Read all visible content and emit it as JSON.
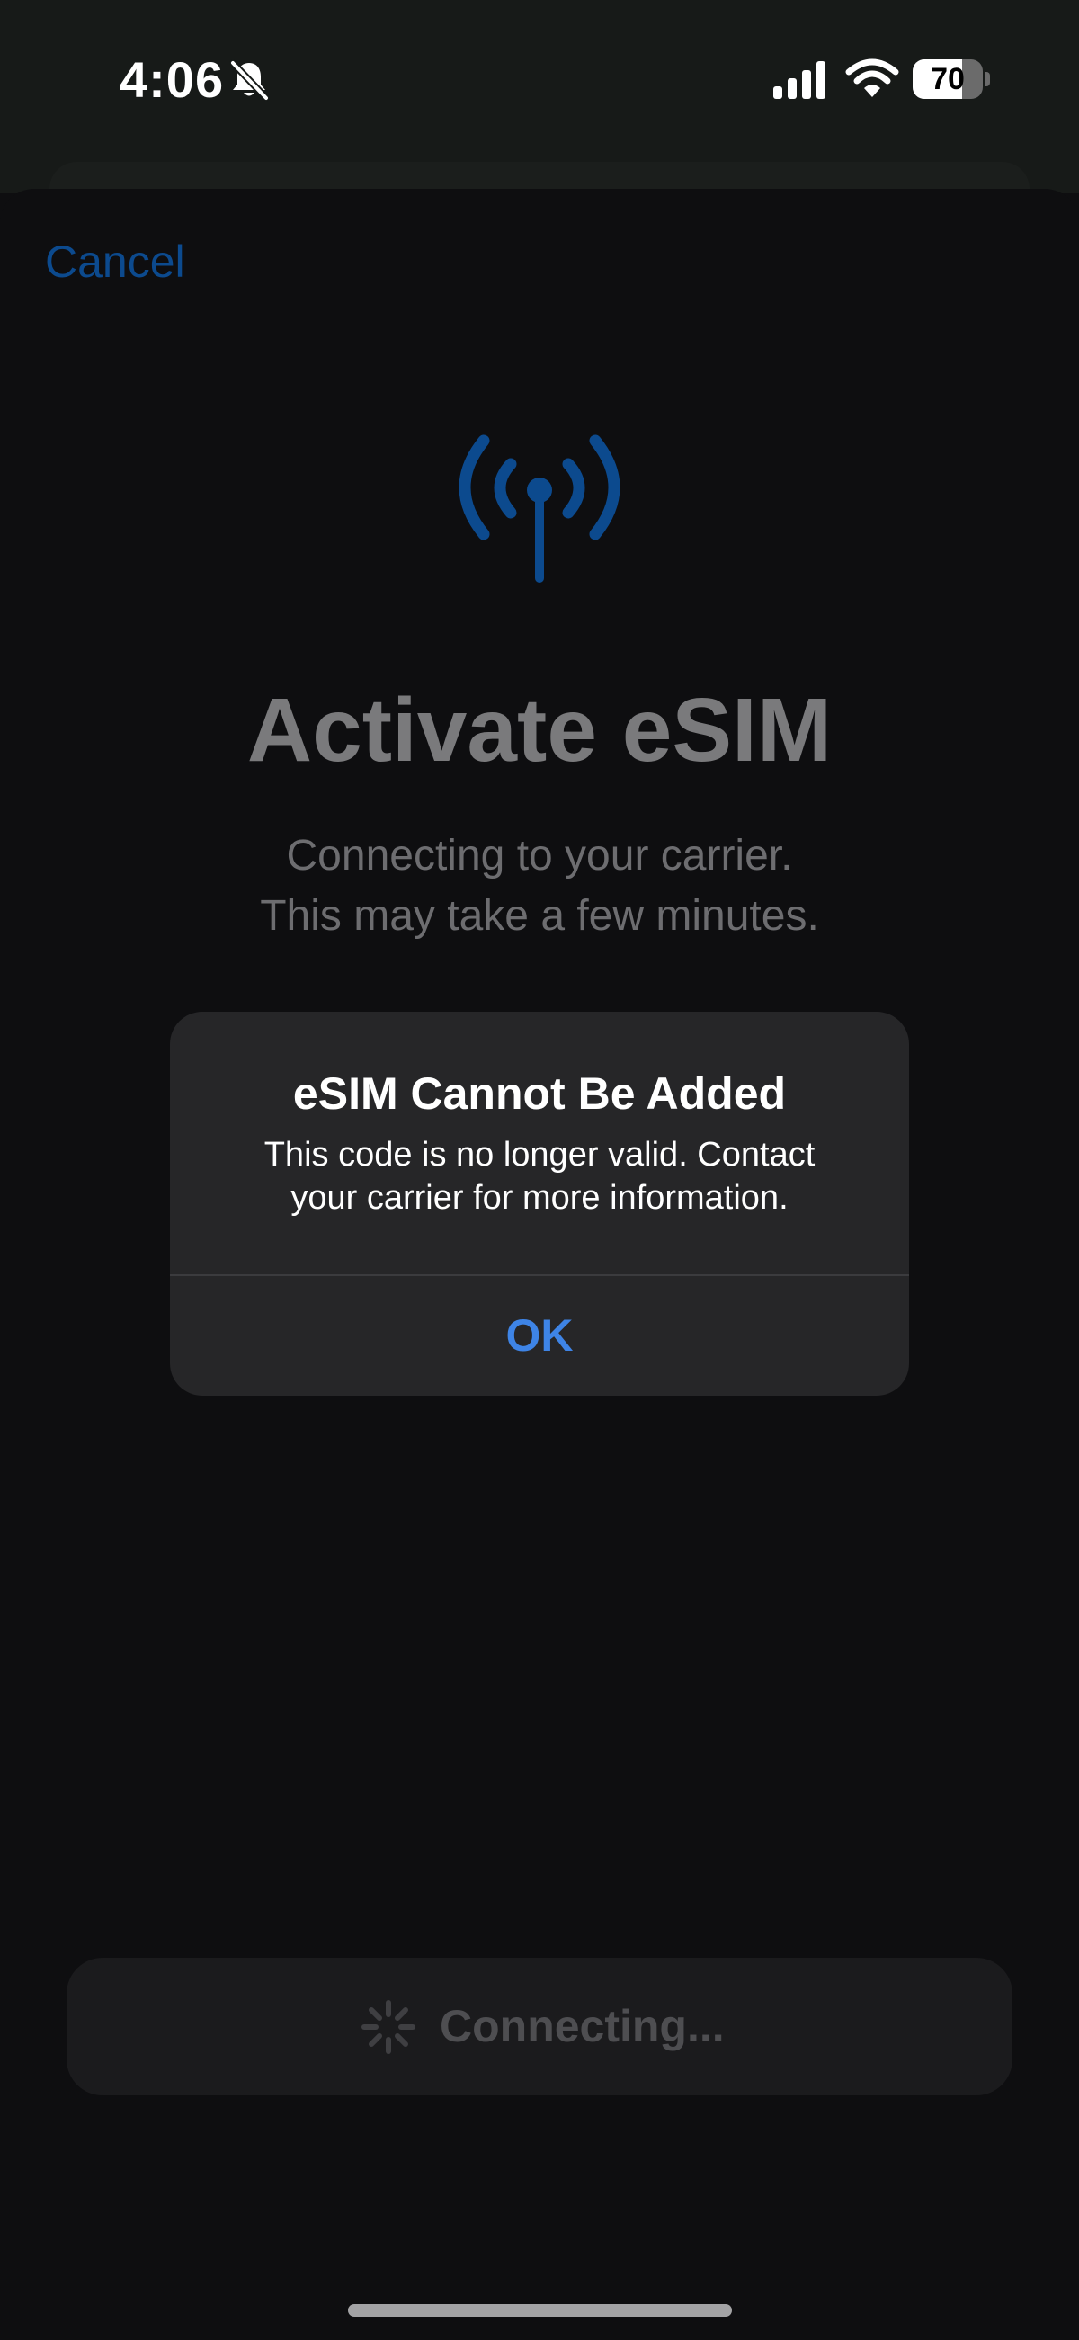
{
  "status_bar": {
    "time": "4:06",
    "battery_level": "70",
    "battery_fraction": 0.7,
    "icons": [
      "bell-slash-icon",
      "cellular-signal-icon",
      "wifi-icon",
      "battery-icon"
    ]
  },
  "nav": {
    "cancel_label": "Cancel"
  },
  "hero": {
    "icon": "antenna-icon",
    "title": "Activate eSIM",
    "subtitle_line1": "Connecting to your carrier.",
    "subtitle_line2": "This may take a few minutes."
  },
  "alert": {
    "title": "eSIM Cannot Be Added",
    "message_line1": "This code is no longer valid. Contact",
    "message_line2": "your carrier for more information.",
    "ok_label": "OK"
  },
  "footer": {
    "button_label": "Connecting...",
    "icon": "spinner-icon"
  },
  "colors": {
    "accent": "#3e84e6",
    "dim_accent": "#0c4a8e",
    "background": "#0e0e10",
    "alert_background": "#262628"
  }
}
